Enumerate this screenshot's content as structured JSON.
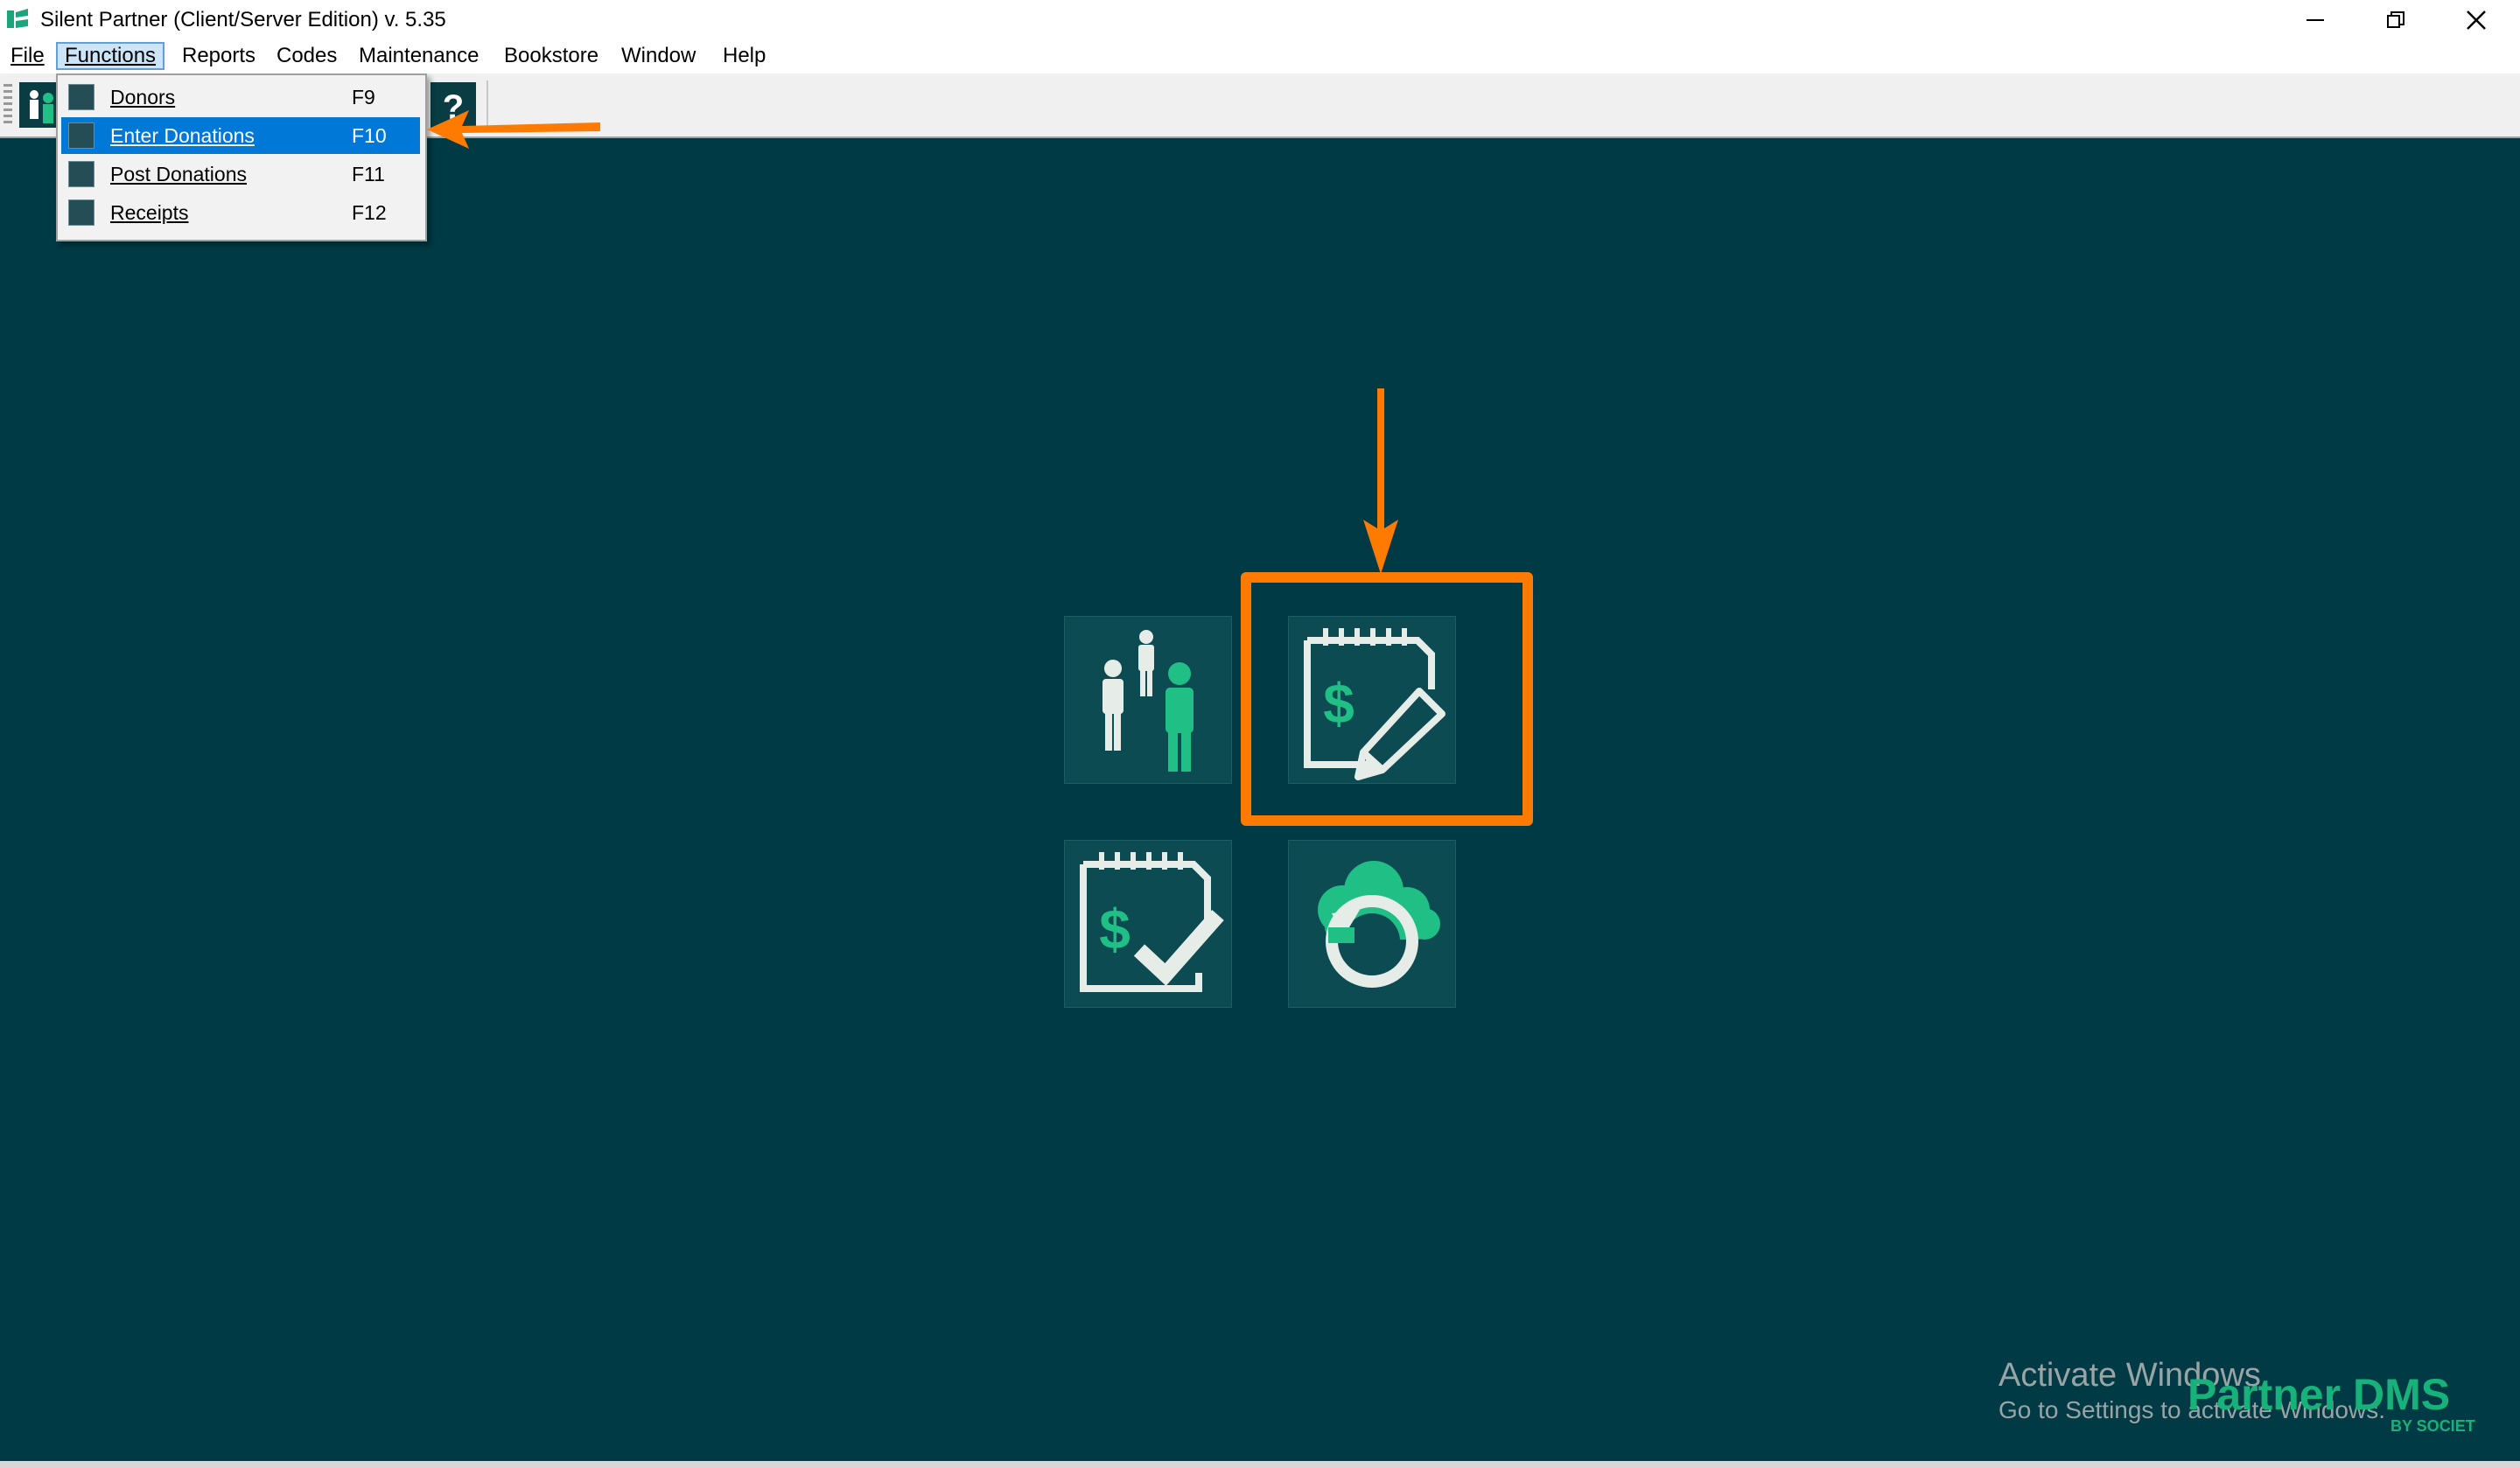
{
  "window": {
    "title": "Silent Partner (Client/Server Edition) v. 5.35",
    "controls": [
      "minimize",
      "restore",
      "close"
    ]
  },
  "menubar": {
    "items": [
      {
        "label": "File",
        "active": false
      },
      {
        "label": "Functions",
        "active": true
      },
      {
        "label": "Reports",
        "active": false
      },
      {
        "label": "Codes",
        "active": false
      },
      {
        "label": "Maintenance",
        "active": false
      },
      {
        "label": "Bookstore",
        "active": false
      },
      {
        "label": "Window",
        "active": false
      },
      {
        "label": "Help",
        "active": false
      }
    ]
  },
  "functions_menu": {
    "items": [
      {
        "label": "Donors",
        "shortcut": "F9",
        "icon": "donors-icon",
        "selected": false
      },
      {
        "label": "Enter Donations",
        "shortcut": "F10",
        "icon": "enter-donations-icon",
        "selected": true
      },
      {
        "label": "Post Donations",
        "shortcut": "F11",
        "icon": "post-donations-icon",
        "selected": false
      },
      {
        "label": "Receipts",
        "shortcut": "F12",
        "icon": "receipts-icon",
        "selected": false
      }
    ]
  },
  "toolbar": {
    "buttons": [
      "donors-icon",
      "help-icon"
    ],
    "help_glyph": "?"
  },
  "tiles": [
    {
      "name": "donors",
      "icon": "donors-icon"
    },
    {
      "name": "enter-donations",
      "icon": "enter-donations-icon",
      "highlighted": true
    },
    {
      "name": "post-donations",
      "icon": "post-donations-icon"
    },
    {
      "name": "sync",
      "icon": "cloud-sync-icon"
    }
  ],
  "watermark": {
    "line1": "Activate Windows",
    "line2": "Go to Settings to activate Windows."
  },
  "brand": {
    "name": "Partner DMS",
    "sub": "BY SOCIET"
  },
  "colors": {
    "background": "#003a44",
    "accent_orange": "#ff7a00",
    "brand_green": "#17b27a",
    "menu_selected": "#0078d7"
  }
}
